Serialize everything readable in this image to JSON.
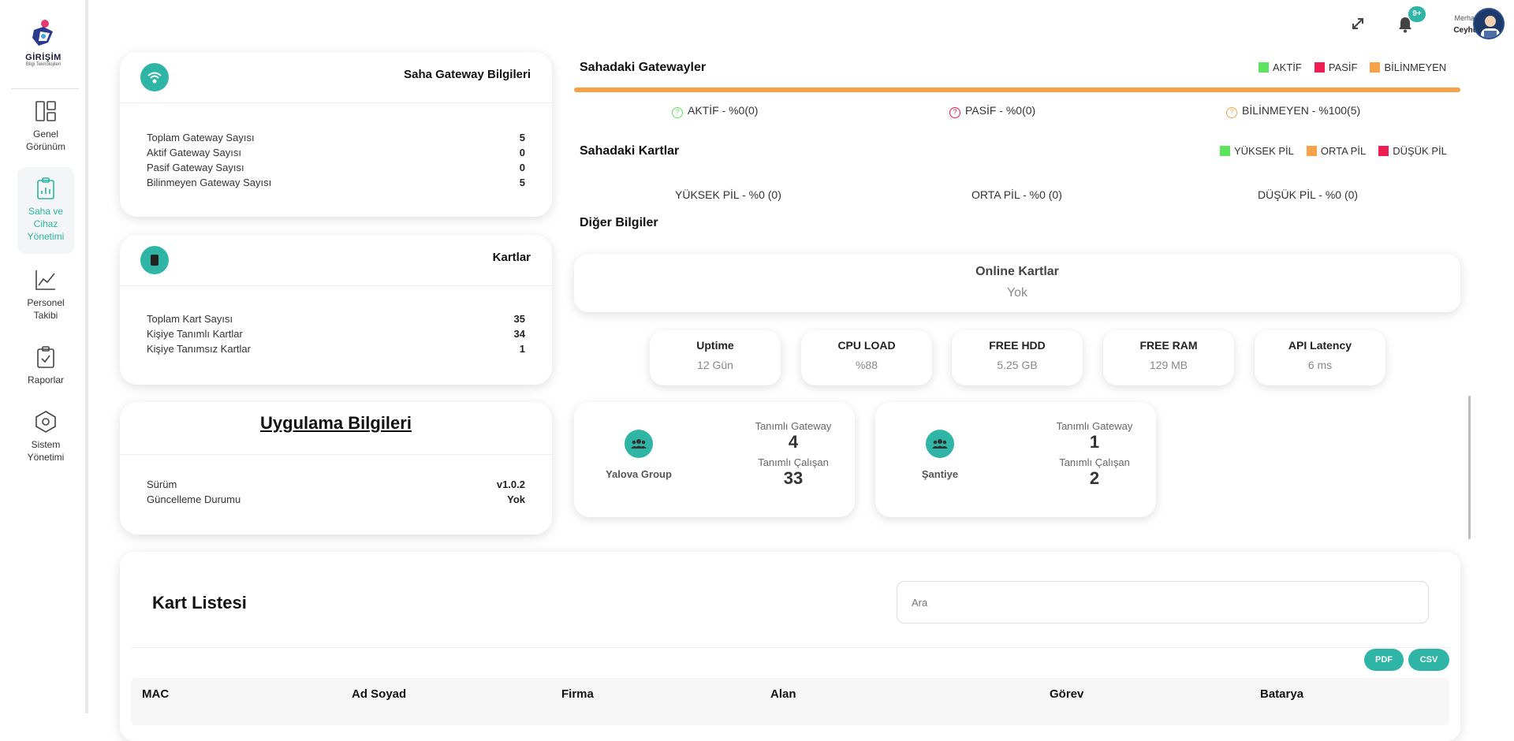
{
  "brand": {
    "name": "GİRİŞİM",
    "tagline": "Bilgi Teknolojileri"
  },
  "sidebar": {
    "items": [
      {
        "label": "Genel Görünüm"
      },
      {
        "label": "Saha ve Cihaz Yönetimi"
      },
      {
        "label": "Personel Takibi"
      },
      {
        "label": "Raporlar"
      },
      {
        "label": "Sistem Yönetimi"
      }
    ]
  },
  "topbar": {
    "notification_badge": "9+",
    "greeting": "Merhaba",
    "user_name": "Ceyhun"
  },
  "gateway_card": {
    "title": "Saha Gateway Bilgileri",
    "rows": [
      {
        "label": "Toplam Gateway Sayısı",
        "value": "5"
      },
      {
        "label": "Aktif Gateway Sayısı",
        "value": "0"
      },
      {
        "label": "Pasif Gateway Sayısı",
        "value": "0"
      },
      {
        "label": "Bilinmeyen Gateway Sayısı",
        "value": "5"
      }
    ]
  },
  "cards_card": {
    "title": "Kartlar",
    "rows": [
      {
        "label": "Toplam Kart Sayısı",
        "value": "35"
      },
      {
        "label": "Kişiye Tanımlı Kartlar",
        "value": "34"
      },
      {
        "label": "Kişiye Tanımsız Kartlar",
        "value": "1"
      }
    ]
  },
  "app_card": {
    "title": "Uygulama Bilgileri",
    "rows": [
      {
        "label": "Sürüm",
        "value": "v1.0.2"
      },
      {
        "label": "Güncelleme Durumu",
        "value": "Yok"
      }
    ]
  },
  "field_gateways": {
    "title": "Sahadaki Gatewayler",
    "legend": [
      {
        "label": "AKTİF",
        "color": "#5ee35e"
      },
      {
        "label": "PASİF",
        "color": "#ee1d52"
      },
      {
        "label": "BİLİNMEYEN",
        "color": "#f7a24b"
      }
    ],
    "bar_color": "#f7a24b",
    "stats": [
      {
        "label": "AKTİF - %0(0)",
        "color": "#5ee35e"
      },
      {
        "label": "PASİF - %0(0)",
        "color": "#ee1d52"
      },
      {
        "label": "BİLİNMEYEN - %100(5)",
        "color": "#f7a24b"
      }
    ]
  },
  "field_cards": {
    "title": "Sahadaki Kartlar",
    "legend": [
      {
        "label": "YÜKSEK PİL",
        "color": "#5ee35e"
      },
      {
        "label": "ORTA PİL",
        "color": "#f7a24b"
      },
      {
        "label": "DÜŞÜK PİL",
        "color": "#ee1d52"
      }
    ],
    "stats": [
      {
        "label": "YÜKSEK PİL - %0 (0)"
      },
      {
        "label": "ORTA PİL - %0 (0)"
      },
      {
        "label": "DÜŞÜK PİL - %0 (0)"
      }
    ]
  },
  "other_info": {
    "title": "Diğer Bilgiler",
    "online_cards": {
      "title": "Online Kartlar",
      "value": "Yok"
    },
    "metrics": [
      {
        "title": "Uptime",
        "value": "12 Gün"
      },
      {
        "title": "CPU LOAD",
        "value": "%88"
      },
      {
        "title": "FREE HDD",
        "value": "5.25 GB"
      },
      {
        "title": "FREE RAM",
        "value": "129 MB"
      },
      {
        "title": "API Latency",
        "value": "6 ms"
      }
    ],
    "groups": [
      {
        "name": "Yalova Group",
        "gateway_label": "Tanımlı Gateway",
        "gateway_count": "4",
        "employee_label": "Tanımlı Çalışan",
        "employee_count": "33"
      },
      {
        "name": "Şantiye",
        "gateway_label": "Tanımlı Gateway",
        "gateway_count": "1",
        "employee_label": "Tanımlı Çalışan",
        "employee_count": "2"
      }
    ]
  },
  "card_list": {
    "title": "Kart Listesi",
    "search_placeholder": "Ara",
    "pdf_label": "PDF",
    "csv_label": "CSV",
    "columns": [
      "MAC",
      "Ad Soyad",
      "Firma",
      "Alan",
      "Görev",
      "Batarya"
    ]
  }
}
